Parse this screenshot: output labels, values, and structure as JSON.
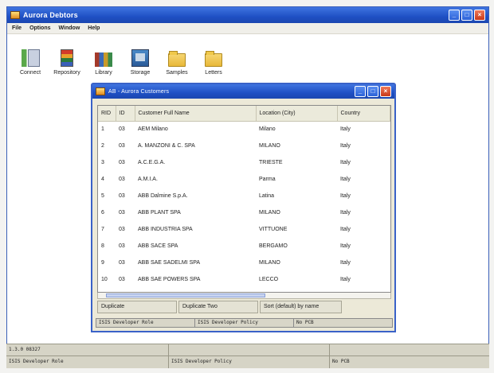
{
  "app": {
    "title": "Aurora Debtors"
  },
  "menu": [
    "File",
    "Options",
    "Window",
    "Help"
  ],
  "toolbar": [
    {
      "label": "Connect",
      "icon": "connect-icon"
    },
    {
      "label": "Repository",
      "icon": "repository-icon"
    },
    {
      "label": "Library",
      "icon": "library-icon"
    },
    {
      "label": "Storage",
      "icon": "storage-icon"
    },
    {
      "label": "Samples",
      "icon": "folder-icon"
    },
    {
      "label": "Letters",
      "icon": "folder-icon"
    }
  ],
  "child": {
    "title": "AB - Aurora Customers",
    "columns": [
      "RID",
      "ID",
      "Customer Full Name",
      "Location (City)",
      "Country"
    ],
    "rows": [
      [
        "1",
        "03",
        "AEM Milano",
        "Milano",
        "Italy"
      ],
      [
        "2",
        "03",
        "A. MANZONI & C. SPA",
        "MILANO",
        "Italy"
      ],
      [
        "3",
        "03",
        "A.C.E.G.A.",
        "TRIESTE",
        "Italy"
      ],
      [
        "4",
        "03",
        "A.M.I.A.",
        "Parma",
        "Italy"
      ],
      [
        "5",
        "03",
        "ABB Dalmine S.p.A.",
        "Latina",
        "Italy"
      ],
      [
        "6",
        "03",
        "ABB PLANT SPA",
        "MILANO",
        "Italy"
      ],
      [
        "7",
        "03",
        "ABB INDUSTRIA SPA",
        "VITTUONE",
        "Italy"
      ],
      [
        "8",
        "03",
        "ABB SACE SPA",
        "BERGAMO",
        "Italy"
      ],
      [
        "9",
        "03",
        "ABB SAE SADELMI SPA",
        "MILANO",
        "Italy"
      ],
      [
        "10",
        "03",
        "ABB SAE POWERS SPA",
        "LECCO",
        "Italy"
      ]
    ],
    "tabs": [
      "Duplicate",
      "Duplicate Two",
      "Sort (default) by name"
    ],
    "status": [
      "ISIS Developer Role",
      "ISIS Developer Policy",
      "No PCB"
    ]
  },
  "statusbar": {
    "top": [
      "1.3.0 08327",
      "",
      ""
    ],
    "bottom": [
      "ISIS Developer Role",
      "ISIS Developer Policy",
      "No PCB"
    ]
  }
}
